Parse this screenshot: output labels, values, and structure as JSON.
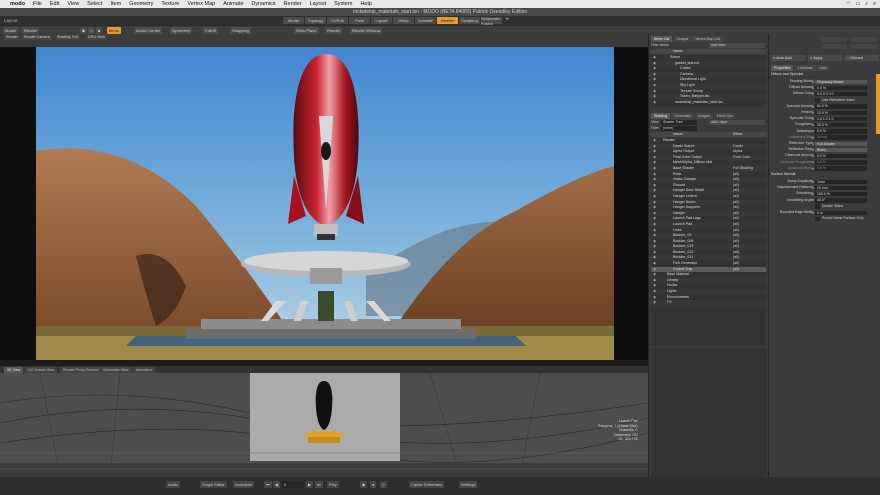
{
  "menubar": {
    "app": "modo",
    "items": [
      "File",
      "Edit",
      "View",
      "Select",
      "Item",
      "Geometry",
      "Texture",
      "Vertex Map",
      "Animate",
      "Dynamics",
      "Render",
      "Layout",
      "System",
      "Help"
    ]
  },
  "window": {
    "title": "rocketship_materials_start.lxo - MODO (BETA 84083) Patrick Oxendley Edition",
    "layout_label": "Layout"
  },
  "layout_tabs": [
    "Model",
    "Topology",
    "UVEdit",
    "Paint",
    "Layout",
    "Setup",
    "Animate",
    "Render",
    "Sculpting",
    "Schematic Fusion"
  ],
  "active_tab": "Render",
  "toolbar": {
    "items": [
      "Model",
      "Render",
      "Items",
      "Action Center",
      "Symmetry",
      "Falloff",
      "Snapping",
      "Work Plane",
      "Render",
      "Render Window"
    ]
  },
  "viewport": {
    "tabs": [
      "Render",
      "Render Camera",
      "Shading: Full",
      "GPU: Auto"
    ]
  },
  "item_panel": {
    "tabs": [
      "Items List",
      "Groups",
      "Vertex Map List"
    ],
    "filter_label": "Filter Items",
    "add_item": "Add Item",
    "header": "Name",
    "items": [
      {
        "name": "Scene",
        "indent": 1
      },
      {
        "name": "gasket_test.lxo",
        "indent": 2
      },
      {
        "name": "Cubes",
        "indent": 3
      },
      {
        "name": "Camera",
        "indent": 3
      },
      {
        "name": "Directional Light",
        "indent": 3
      },
      {
        "name": "Sky Light",
        "indent": 3
      },
      {
        "name": "Texture Group",
        "indent": 3
      },
      {
        "name": "Token_Babyah.lxo",
        "indent": 3
      },
      {
        "name": "rocketship_materials_start.lxo",
        "indent": 2
      }
    ]
  },
  "shader_panel": {
    "tabs": [
      "Shading",
      "Schematic",
      "Images",
      "Mesh Ops"
    ],
    "view_label": "View",
    "view_value": "Shader Tree",
    "add_layer": "Add Layer",
    "filter_label": "Filter",
    "filter_value": "(none)",
    "col_name": "Name",
    "col_effect": "Effect",
    "layers": [
      {
        "name": "Render",
        "effect": ""
      },
      {
        "name": "Depth Output",
        "effect": "Depth"
      },
      {
        "name": "Alpha Output",
        "effect": "Alpha"
      },
      {
        "name": "Final Color Output",
        "effect": "Final Color"
      },
      {
        "name": "Mesh/Alpha_Diffuse-Mat",
        "effect": ""
      },
      {
        "name": "Base Shader",
        "effect": "Full Shading"
      },
      {
        "name": "Rock",
        "effect": "(all)"
      },
      {
        "name": "Grass Clumps",
        "effect": "(all)"
      },
      {
        "name": "Ground",
        "effect": "(all)"
      },
      {
        "name": "Hanger Door Detail",
        "effect": "(all)"
      },
      {
        "name": "Hanger Letters",
        "effect": "(all)"
      },
      {
        "name": "Hanger Doors",
        "effect": "(all)"
      },
      {
        "name": "Hanger Supports",
        "effect": "(all)"
      },
      {
        "name": "Hanger",
        "effect": "(all)"
      },
      {
        "name": "Launch Pad Legs",
        "effect": "(all)"
      },
      {
        "name": "Launch Pad",
        "effect": "(all)"
      },
      {
        "name": "Lines",
        "effect": "(all)"
      },
      {
        "name": "Boulder_03",
        "effect": "(all)"
      },
      {
        "name": "Boulder_008",
        "effect": "(all)"
      },
      {
        "name": "Boulder_013",
        "effect": "(all)"
      },
      {
        "name": "Boulder_012",
        "effect": "(all)"
      },
      {
        "name": "Boulder_011",
        "effect": "(all)"
      },
      {
        "name": "Fuel Generator",
        "effect": "(all)"
      },
      {
        "name": "Rocket Ship",
        "effect": "(all)"
      },
      {
        "name": "Base Material",
        "effect": ""
      },
      {
        "name": "Library",
        "effect": ""
      },
      {
        "name": "Nodes",
        "effect": ""
      },
      {
        "name": "Lights",
        "effect": ""
      },
      {
        "name": "Environments",
        "effect": ""
      },
      {
        "name": "FX",
        "effect": ""
      }
    ],
    "selected_index": 23
  },
  "properties": {
    "header_buttons": [
      "Auto Add",
      "Apply",
      "Discard"
    ],
    "tabs": [
      "Properties",
      "Channels",
      "Lists"
    ],
    "rows": [
      {
        "type": "section",
        "label": "Diffuse and Specular"
      },
      {
        "label": "Shading Model",
        "value": "Physically Based",
        "kind": "select"
      },
      {
        "label": "Diffuse Amount",
        "value": "0.0 %"
      },
      {
        "label": "Diffuse Color",
        "value": "0.0    0.0    0.0"
      },
      {
        "type": "check",
        "label": "Use Refractive Index"
      },
      {
        "label": "Specular Amount",
        "value": "61.0 %"
      },
      {
        "label": "Fresnel",
        "value": "12.0 %"
      },
      {
        "label": "Specular Color",
        "value": "1.0    1.0    1.0"
      },
      {
        "label": "Roughness",
        "value": "25.0 %"
      },
      {
        "label": "Anisotropy",
        "value": "0.0 %"
      },
      {
        "label": "Anisotropy Map",
        "value": "(none)",
        "kind": "dim"
      },
      {
        "label": "Reflection Type",
        "value": "Full Shader",
        "kind": "select"
      },
      {
        "label": "Reflection Rays",
        "value": "Blurry",
        "kind": "select"
      },
      {
        "label": "Clearcoat Amount",
        "value": "0.0 %"
      },
      {
        "label": "Clearcoat Roughness",
        "value": "0.0 %",
        "kind": "dim"
      },
      {
        "label": "Clearcoat Bump",
        "value": "0.0 %",
        "kind": "dim"
      },
      {
        "type": "section",
        "label": "Surface Normal"
      },
      {
        "label": "Bump Amplitude",
        "value": "1mm"
      },
      {
        "label": "Displacement Distance",
        "value": "20 mm"
      },
      {
        "label": "Smoothing",
        "value": "100.0 %"
      },
      {
        "label": "Smoothing Angle",
        "value": "40.0°"
      },
      {
        "type": "check",
        "label": "Double Sided"
      },
      {
        "label": "Rounded Edge Width",
        "value": "0 m"
      },
      {
        "type": "check",
        "label": "Round Same Surface Only"
      }
    ]
  },
  "timeline": {
    "tabs": [
      "3D View",
      "UV Texture View",
      "Render Proxy Preview",
      "Schematic View",
      "Animation"
    ],
    "label_1": "Launch Pad",
    "label_2": "Polygons: 7 (Shade Size)",
    "label_3": "Channels: 0",
    "label_4": "Deformers: ON",
    "label_5": "GL: 424,776"
  },
  "transport": {
    "audio": "Audio",
    "graph_editor": "Graph Editor",
    "animated": "Animated",
    "play": "Play",
    "frame": "0",
    "cache_deformers": "Cache Deformers",
    "settings": "Settings"
  }
}
